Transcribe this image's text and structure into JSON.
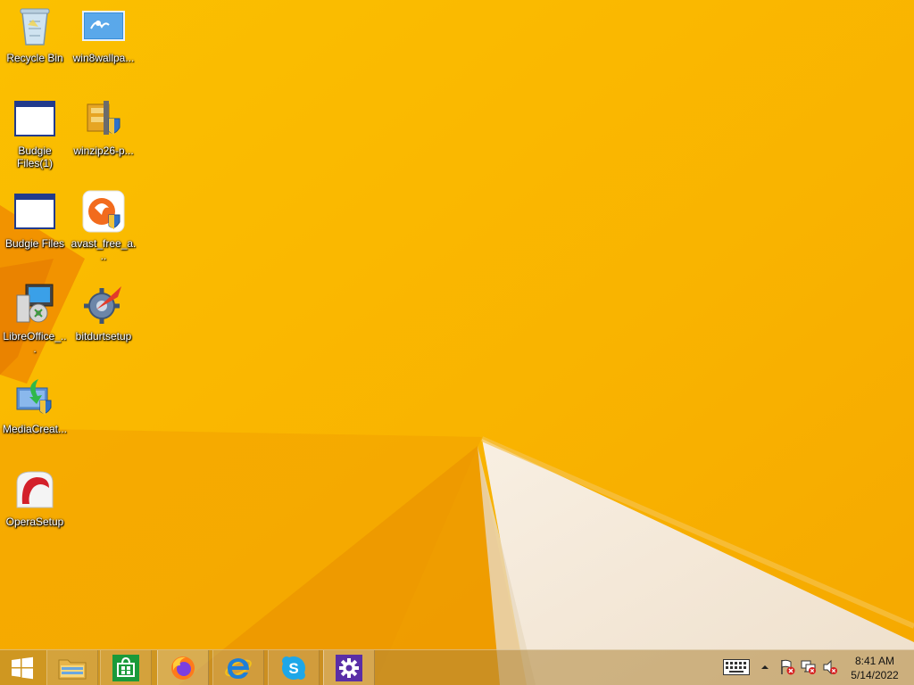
{
  "desktop": {
    "icons": [
      {
        "label": "Recycle Bin",
        "icon": "recycle-bin-icon"
      },
      {
        "label": "win8wallpa...",
        "icon": "image-file-icon"
      },
      {
        "label": "Budgie Files(1)",
        "icon": "window-app-icon"
      },
      {
        "label": "winzip26-p...",
        "icon": "winzip-installer-icon"
      },
      {
        "label": "Budgie Files",
        "icon": "window-app-icon"
      },
      {
        "label": "avast_free_a...",
        "icon": "avast-installer-icon"
      },
      {
        "label": "LibreOffice_...",
        "icon": "libreoffice-installer-icon"
      },
      {
        "label": "bitdurtsetup",
        "icon": "gear-installer-icon"
      },
      {
        "label": "MediaCreat...",
        "icon": "media-creation-tool-icon"
      },
      {
        "label": "OperaSetup",
        "icon": "opera-setup-icon"
      }
    ]
  },
  "taskbar": {
    "buttons": [
      {
        "name": "start-button",
        "icon": "windows-logo-icon"
      },
      {
        "name": "file-explorer-button",
        "icon": "folder-icon"
      },
      {
        "name": "store-button",
        "icon": "store-icon"
      },
      {
        "name": "firefox-button",
        "icon": "firefox-icon"
      },
      {
        "name": "internet-explorer-button",
        "icon": "internet-explorer-icon"
      },
      {
        "name": "skype-button",
        "icon": "skype-icon"
      },
      {
        "name": "settings-button",
        "icon": "gear-icon"
      }
    ],
    "tray": {
      "keyboard": "keyboard-icon",
      "show_hidden": "chevron-up-icon",
      "action_center": "flag-icon",
      "network": "network-icon",
      "volume": "speaker-muted-icon"
    },
    "clock": {
      "time": "8:41 AM",
      "date": "5/14/2022"
    }
  },
  "colors": {
    "wallpaper": "#f8b400",
    "accent_orange": "#f08a00",
    "cream": "#f4e8d8"
  }
}
